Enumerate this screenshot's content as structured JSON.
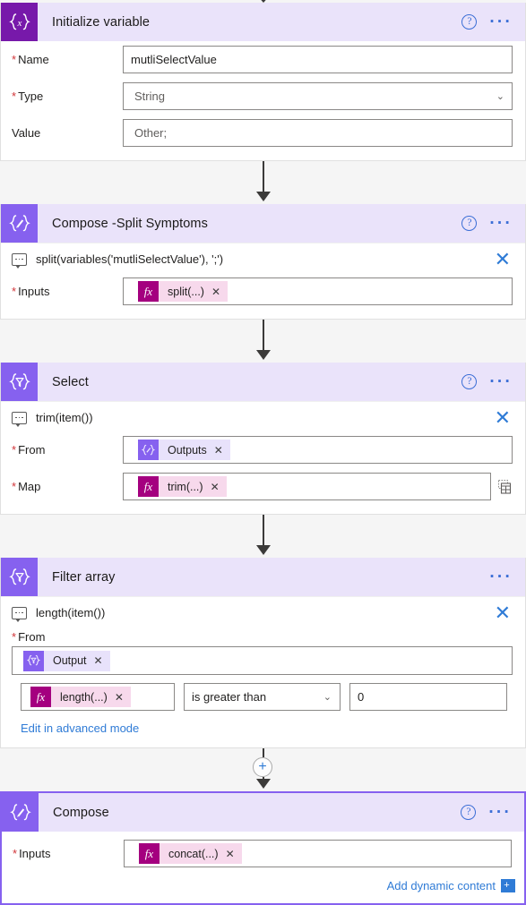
{
  "flow": {
    "cards": [
      {
        "id": "initialize-variable",
        "title": "Initialize variable",
        "icon": "variable-braces-x-icon",
        "icon_glyph": "{x}",
        "icon_shade": "deep",
        "has_help": true,
        "has_ellipsis": true,
        "fields": [
          {
            "label": "Name",
            "required": true,
            "value": "mutliSelectValue",
            "kind": "text"
          },
          {
            "label": "Type",
            "required": true,
            "value": "String",
            "kind": "dropdown"
          },
          {
            "label": "Value",
            "required": false,
            "value": "Other;",
            "kind": "text"
          }
        ]
      },
      {
        "id": "compose-split-symptoms",
        "title": "Compose -Split Symptoms",
        "icon": "compose-pencil-braces-icon",
        "icon_shade": "medium",
        "has_help": true,
        "has_ellipsis": true,
        "comment": "split(variables('mutliSelectValue'), ';')",
        "fields": [
          {
            "label": "Inputs",
            "required": true,
            "kind": "token",
            "token": {
              "type": "fx",
              "label": "split(...)"
            }
          }
        ]
      },
      {
        "id": "select",
        "title": "Select",
        "icon": "select-funnel-braces-icon",
        "icon_shade": "medium",
        "has_help": true,
        "has_ellipsis": true,
        "comment": "trim(item())",
        "fields": [
          {
            "label": "From",
            "required": true,
            "kind": "token",
            "token": {
              "type": "compose",
              "label": "Outputs"
            }
          },
          {
            "label": "Map",
            "required": true,
            "kind": "token",
            "trailing_icon": "grid-view-icon",
            "token": {
              "type": "fx",
              "label": "trim(...)"
            }
          }
        ]
      },
      {
        "id": "filter-array",
        "title": "Filter array",
        "icon": "filter-funnel-braces-icon",
        "icon_shade": "medium",
        "has_help": false,
        "has_ellipsis": true,
        "comment": "length(item())",
        "from_label": "From",
        "from_token": {
          "type": "select",
          "label": "Output"
        },
        "condition": {
          "left_token": {
            "type": "fx",
            "label": "length(...)"
          },
          "operator": "is greater than",
          "right_value": "0"
        },
        "advanced_link": "Edit in advanced mode"
      },
      {
        "id": "compose",
        "title": "Compose",
        "icon": "compose-pencil-braces-icon",
        "icon_shade": "medium",
        "has_help": true,
        "has_ellipsis": true,
        "selected": true,
        "fields": [
          {
            "label": "Inputs",
            "required": true,
            "kind": "token",
            "token": {
              "type": "fx",
              "label": "concat(...)"
            }
          }
        ],
        "dynamic_content": {
          "label": "Add dynamic content",
          "badge": "+"
        }
      }
    ],
    "connectors": [
      {
        "type": "arrow"
      },
      {
        "type": "arrow"
      },
      {
        "type": "arrow"
      },
      {
        "type": "plus-arrow",
        "plus_label": "+"
      }
    ]
  },
  "icons": {
    "help": "?",
    "ellipsis": "···",
    "close": "✕",
    "chevron_down": "⌄",
    "token_remove": "✕",
    "fx": "fx",
    "funnel": "▽",
    "pencil": "✎"
  },
  "colors": {
    "header_bg": "#eae3fa",
    "icon_deep": "#7719aa",
    "icon_medium": "#8661ef",
    "fx_token": "#a4007f",
    "link": "#2f7bd6",
    "required": "#d13438",
    "canvas": "#f5f5f5"
  }
}
